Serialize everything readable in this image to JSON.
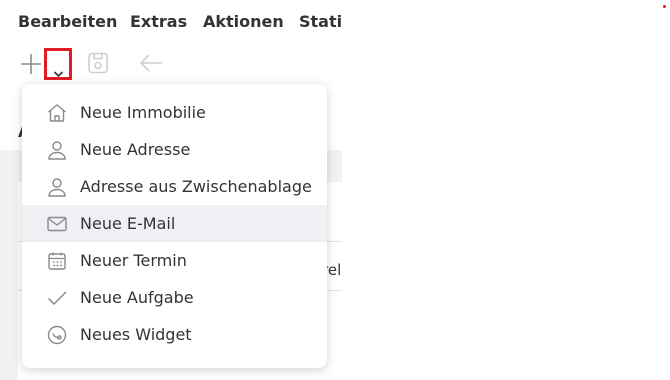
{
  "menubar": {
    "items": [
      {
        "label": "Bearbeiten"
      },
      {
        "label": "Extras"
      },
      {
        "label": "Aktionen"
      },
      {
        "label": "Statis"
      }
    ]
  },
  "toolbar": {
    "add_icon": "plus-icon",
    "dropdown_icon": "chevron-down-icon",
    "save_icon": "save-icon",
    "back_icon": "arrow-left-icon",
    "highlight_color": "#e31b23"
  },
  "background": {
    "partial_letter": "A",
    "partial_text": "rel"
  },
  "menu": {
    "items": [
      {
        "label": "Neue Immobilie",
        "icon": "house-icon"
      },
      {
        "label": "Neue Adresse",
        "icon": "person-icon"
      },
      {
        "label": "Adresse aus Zwischenablage",
        "icon": "person-icon"
      },
      {
        "label": "Neue E-Mail",
        "icon": "envelope-icon",
        "active": true
      },
      {
        "label": "Neuer Termin",
        "icon": "calendar-icon"
      },
      {
        "label": "Neue Aufgabe",
        "icon": "checkmark-icon"
      },
      {
        "label": "Neues Widget",
        "icon": "widget-icon"
      }
    ],
    "active_bg": "#eef0f4"
  }
}
